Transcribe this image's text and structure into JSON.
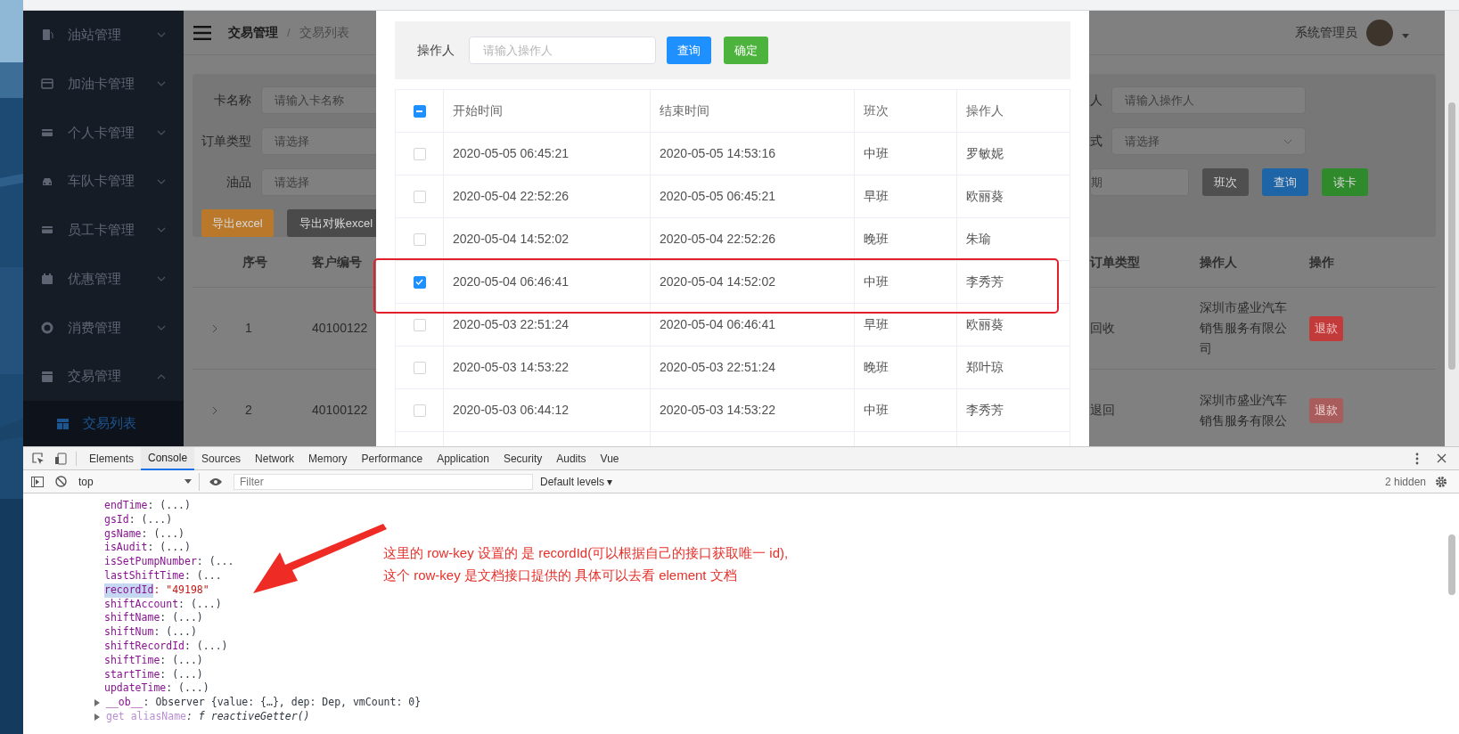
{
  "sidebar": {
    "items": [
      {
        "label": "油站管理",
        "expanded": false
      },
      {
        "label": "加油卡管理",
        "expanded": false
      },
      {
        "label": "个人卡管理",
        "expanded": false
      },
      {
        "label": "车队卡管理",
        "expanded": false
      },
      {
        "label": "员工卡管理",
        "expanded": false
      },
      {
        "label": "优惠管理",
        "expanded": false
      },
      {
        "label": "消费管理",
        "expanded": false
      },
      {
        "label": "交易管理",
        "expanded": true,
        "children": [
          {
            "label": "交易列表",
            "selected": true
          }
        ]
      }
    ]
  },
  "header": {
    "breadcrumb": [
      "交易管理",
      "交易列表"
    ],
    "separator": "/",
    "user": "系统管理员"
  },
  "filters": {
    "left": [
      {
        "label": "卡名称",
        "placeholder": "请输入卡名称"
      },
      {
        "label": "订单类型",
        "placeholder": "请选择"
      },
      {
        "label": "油品",
        "placeholder": "请选择"
      }
    ],
    "right": [
      {
        "label": "人",
        "placeholder": "请输入操作人",
        "kind": "input"
      },
      {
        "label": "式",
        "placeholder": "请选择",
        "kind": "select"
      }
    ],
    "date_placeholder": "期",
    "search_buttons": [
      {
        "label": "班次",
        "color": "#4f4f4f"
      },
      {
        "label": "查询",
        "color": "#1d65a6"
      },
      {
        "label": "读卡",
        "color": "#2f8a2c"
      }
    ],
    "export_buttons": [
      {
        "label": "导出excel",
        "color": "#b9782a"
      },
      {
        "label": "导出对账excel",
        "color": "#4a4a4a"
      }
    ]
  },
  "table": {
    "columns": [
      "序号",
      "客户编号",
      "订单类型",
      "操作人",
      "操作"
    ],
    "rows": [
      {
        "index": "1",
        "customer": "40100122",
        "order_type": "回收",
        "operator": "深圳市盛业汽车销售服务有限公司",
        "action": "退款",
        "disabled": false
      },
      {
        "index": "2",
        "customer": "40100122",
        "order_type": "退回",
        "operator": "深圳市盛业汽车销售服务有限公",
        "action": "退款",
        "disabled": true
      }
    ]
  },
  "dialog": {
    "filter_label": "操作人",
    "filter_placeholder": "请输入操作人",
    "buttons": [
      {
        "label": "查询",
        "color": "#1e90ff"
      },
      {
        "label": "确定",
        "color": "#4cb43c"
      }
    ],
    "all_indeterminate": true,
    "columns": [
      "开始时间",
      "结束时间",
      "班次",
      "操作人"
    ],
    "rows": [
      {
        "start": "2020-05-05 06:45:21",
        "end": "2020-05-05 14:53:16",
        "shift": "中班",
        "operator": "罗敏妮",
        "checked": false,
        "annotated": false
      },
      {
        "start": "2020-05-04 22:52:26",
        "end": "2020-05-05 06:45:21",
        "shift": "早班",
        "operator": "欧丽葵",
        "checked": false,
        "annotated": false
      },
      {
        "start": "2020-05-04 14:52:02",
        "end": "2020-05-04 22:52:26",
        "shift": "晚班",
        "operator": "朱瑜",
        "checked": false,
        "annotated": false
      },
      {
        "start": "2020-05-04 06:46:41",
        "end": "2020-05-04 14:52:02",
        "shift": "中班",
        "operator": "李秀芳",
        "checked": true,
        "annotated": true
      },
      {
        "start": "2020-05-03 22:51:24",
        "end": "2020-05-04 06:46:41",
        "shift": "早班",
        "operator": "欧丽葵",
        "checked": false,
        "annotated": false
      },
      {
        "start": "2020-05-03 14:53:22",
        "end": "2020-05-03 22:51:24",
        "shift": "晚班",
        "operator": "郑叶琼",
        "checked": false,
        "annotated": false
      },
      {
        "start": "2020-05-03 06:44:12",
        "end": "2020-05-03 14:53:22",
        "shift": "中班",
        "operator": "李秀芳",
        "checked": false,
        "annotated": false
      }
    ]
  },
  "devtools": {
    "tabs": [
      {
        "label": "Elements",
        "selected": false
      },
      {
        "label": "Console",
        "selected": true
      },
      {
        "label": "Sources",
        "selected": false
      },
      {
        "label": "Network",
        "selected": false
      },
      {
        "label": "Memory",
        "selected": false
      },
      {
        "label": "Performance",
        "selected": false
      },
      {
        "label": "Application",
        "selected": false
      },
      {
        "label": "Security",
        "selected": false
      },
      {
        "label": "Audits",
        "selected": false
      },
      {
        "label": "Vue",
        "selected": false
      }
    ],
    "context": "top",
    "filter_placeholder": "Filter",
    "levels": "Default levels ▾",
    "hidden": "2 hidden",
    "lines": [
      {
        "kind": "property",
        "key": "endTime",
        "value": ": (...)",
        "selected": false
      },
      {
        "kind": "property",
        "key": "gsId",
        "value": ": (...)",
        "selected": false
      },
      {
        "kind": "property",
        "key": "gsName",
        "value": ": (...)",
        "selected": false
      },
      {
        "kind": "property",
        "key": "isAudit",
        "value": ": (...)",
        "selected": false
      },
      {
        "kind": "property",
        "key": "isSetPumpNumber",
        "value": ": (...",
        "selected": false
      },
      {
        "kind": "property",
        "key": "lastShiftTime",
        "value": ": (...",
        "selected": false
      },
      {
        "kind": "string",
        "key": "recordId",
        "value": ": \"49198\"",
        "selected": true
      },
      {
        "kind": "property",
        "key": "shiftAccount",
        "value": ": (...)",
        "selected": false
      },
      {
        "kind": "property",
        "key": "shiftName",
        "value": ": (...)",
        "selected": false
      },
      {
        "kind": "property",
        "key": "shiftNum",
        "value": ": (...)",
        "selected": false
      },
      {
        "kind": "property",
        "key": "shiftRecordId",
        "value": ": (...)",
        "selected": false
      },
      {
        "kind": "property",
        "key": "shiftTime",
        "value": ": (...)",
        "selected": false
      },
      {
        "kind": "property",
        "key": "startTime",
        "value": ": (...)",
        "selected": false
      },
      {
        "kind": "property",
        "key": "updateTime",
        "value": ": (...)",
        "selected": false
      },
      {
        "kind": "object",
        "key": "__ob__",
        "value": ": Observer {value: {…}, dep: Dep, vmCount: 0}",
        "selected": false
      },
      {
        "kind": "accessor",
        "key": "get aliasName",
        "value": ": f reactiveGetter()",
        "selected": false
      }
    ]
  },
  "annotation": {
    "lines": [
      "这里的 row-key 设置的 是 recordId(可以根据自己的接口获取唯一 id),",
      "这个 row-key 是文档接口提供的 具体可以去看 element 文档"
    ]
  }
}
